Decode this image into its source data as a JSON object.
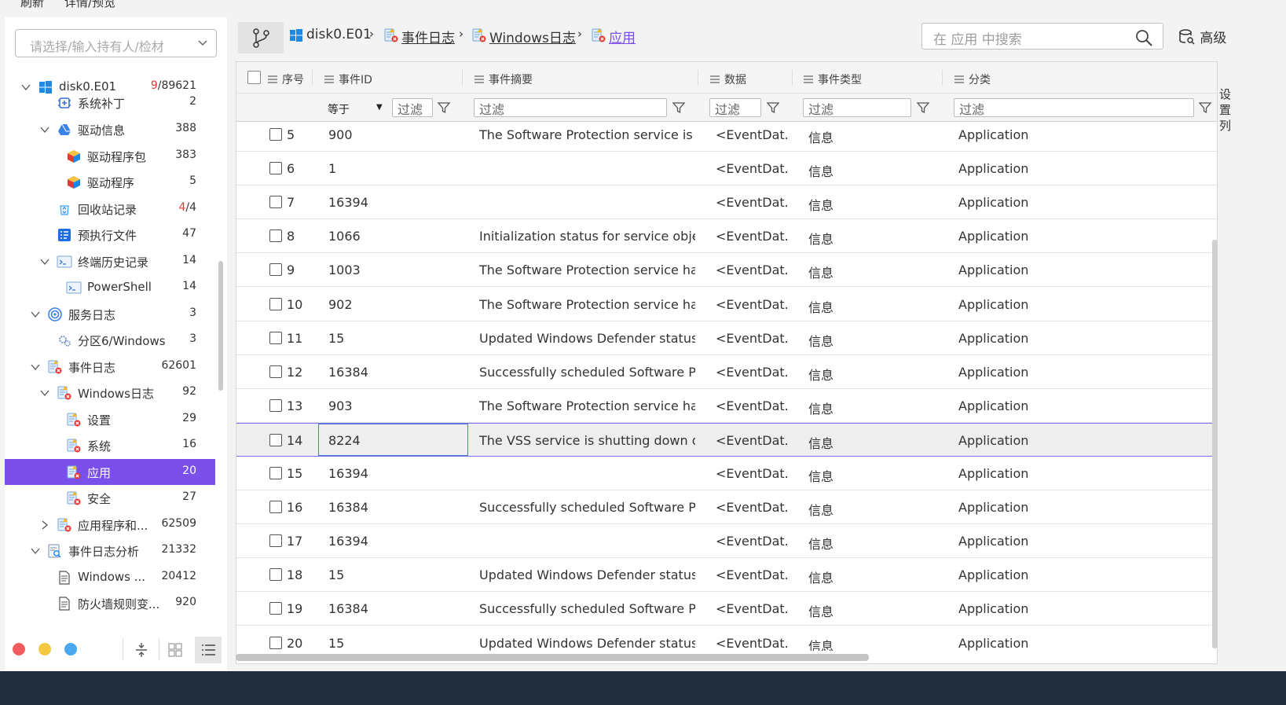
{
  "menu": {
    "refresh": "刷新",
    "detail": "详情/预览"
  },
  "owner_select": {
    "placeholder": "请选择/输入持有人/检材"
  },
  "tree": [
    {
      "label": "disk0.E01",
      "count_red": "9",
      "count": "/89621",
      "icon": "windows-icon",
      "arrow": "down"
    },
    {
      "label": "系统补丁",
      "count": "2",
      "icon": "patch-icon"
    },
    {
      "label": "驱动信息",
      "count": "388",
      "icon": "driver-info-icon",
      "arrow": "down"
    },
    {
      "label": "驱动程序包",
      "count": "383",
      "icon": "package-cube-icon"
    },
    {
      "label": "驱动程序",
      "count": "5",
      "icon": "package-cube-icon"
    },
    {
      "label": "回收站记录",
      "count_red": "4",
      "count": "/4",
      "icon": "recycle-bin-icon"
    },
    {
      "label": "预执行文件",
      "count": "47",
      "icon": "prefetch-icon"
    },
    {
      "label": "终端历史记录",
      "count": "14",
      "icon": "terminal-icon",
      "arrow": "down"
    },
    {
      "label": "PowerShell",
      "count": "14",
      "icon": "terminal-icon"
    },
    {
      "label": "服务日志",
      "count": "3",
      "icon": "service-icon",
      "arrow": "down"
    },
    {
      "label": "分区6/Windows",
      "count": "3",
      "icon": "gears-icon"
    },
    {
      "label": "事件日志",
      "count": "62601",
      "icon": "event-log-icon",
      "arrow": "down"
    },
    {
      "label": "Windows日志",
      "count": "92",
      "icon": "event-log-icon",
      "arrow": "down"
    },
    {
      "label": "设置",
      "count": "29",
      "icon": "event-log-icon"
    },
    {
      "label": "系统",
      "count": "16",
      "icon": "event-log-icon"
    },
    {
      "label": "应用",
      "count": "20",
      "icon": "event-log-icon",
      "selected": true
    },
    {
      "label": "安全",
      "count": "27",
      "icon": "event-log-icon"
    },
    {
      "label": "应用程序和...",
      "count": "62509",
      "icon": "event-log-icon",
      "arrow": "right"
    },
    {
      "label": "事件日志分析",
      "count": "21332",
      "icon": "log-analysis-icon",
      "arrow": "down"
    },
    {
      "label": "Windows ...",
      "count": "20412",
      "icon": "document-icon"
    },
    {
      "label": "防火墙规则变...",
      "count": "920",
      "icon": "document-icon"
    }
  ],
  "colors": {
    "accent": "#7b4fea",
    "dot_red": "#f25c5c",
    "dot_yellow": "#f5c842",
    "dot_blue": "#4aa8f0",
    "count_red": "#e53935"
  },
  "breadcrumb": [
    {
      "label": "disk0.E01",
      "icon": "windows-icon"
    },
    {
      "label": "事件日志",
      "icon": "event-log-icon"
    },
    {
      "label": "Windows日志",
      "icon": "event-log-icon"
    },
    {
      "label": "应用",
      "icon": "event-log-icon"
    }
  ],
  "search": {
    "placeholder": "在 应用 中搜索"
  },
  "advanced_label": "高级",
  "columns": {
    "seq": "序号",
    "event_id": "事件ID",
    "summary": "事件摘要",
    "data": "数据",
    "event_type": "事件类型",
    "category": "分类"
  },
  "filter": {
    "op": "等于",
    "placeholder": "过滤"
  },
  "rows": [
    {
      "seq": "5",
      "id": "900",
      "summary": "The Software Protection service is ...",
      "data": "<EventDat...",
      "type": "信息",
      "cat": "Application"
    },
    {
      "seq": "6",
      "id": "1",
      "summary": "",
      "data": "<EventDat...",
      "type": "信息",
      "cat": "Application"
    },
    {
      "seq": "7",
      "id": "16394",
      "summary": "",
      "data": "<EventDat...",
      "type": "信息",
      "cat": "Application"
    },
    {
      "seq": "8",
      "id": "1066",
      "summary": "Initialization status for service obje...",
      "data": "<EventDat...",
      "type": "信息",
      "cat": "Application"
    },
    {
      "seq": "9",
      "id": "1003",
      "summary": "The Software Protection service ha...",
      "data": "<EventDat...",
      "type": "信息",
      "cat": "Application"
    },
    {
      "seq": "10",
      "id": "902",
      "summary": "The Software Protection service ha...",
      "data": "<EventDat...",
      "type": "信息",
      "cat": "Application"
    },
    {
      "seq": "11",
      "id": "15",
      "summary": "Updated Windows Defender status...",
      "data": "<EventDat...",
      "type": "信息",
      "cat": "Application"
    },
    {
      "seq": "12",
      "id": "16384",
      "summary": "Successfully scheduled Software Pr...",
      "data": "<EventDat...",
      "type": "信息",
      "cat": "Application"
    },
    {
      "seq": "13",
      "id": "903",
      "summary": "The Software Protection service ha...",
      "data": "<EventDat...",
      "type": "信息",
      "cat": "Application"
    },
    {
      "seq": "14",
      "id": "8224",
      "summary": "The VSS service is shutting down d...",
      "data": "<EventDat...",
      "type": "信息",
      "cat": "Application",
      "current": true
    },
    {
      "seq": "15",
      "id": "16394",
      "summary": "",
      "data": "<EventDat...",
      "type": "信息",
      "cat": "Application"
    },
    {
      "seq": "16",
      "id": "16384",
      "summary": "Successfully scheduled Software Pr...",
      "data": "<EventDat...",
      "type": "信息",
      "cat": "Application"
    },
    {
      "seq": "17",
      "id": "16394",
      "summary": "",
      "data": "<EventDat...",
      "type": "信息",
      "cat": "Application"
    },
    {
      "seq": "18",
      "id": "15",
      "summary": "Updated Windows Defender status...",
      "data": "<EventDat...",
      "type": "信息",
      "cat": "Application"
    },
    {
      "seq": "19",
      "id": "16384",
      "summary": "Successfully scheduled Software Pr...",
      "data": "<EventDat...",
      "type": "信息",
      "cat": "Application"
    },
    {
      "seq": "20",
      "id": "15",
      "summary": "Updated Windows Defender status...",
      "data": "<EventDat...",
      "type": "信息",
      "cat": "Application"
    }
  ],
  "right_edge_text": "设\n置\n列"
}
